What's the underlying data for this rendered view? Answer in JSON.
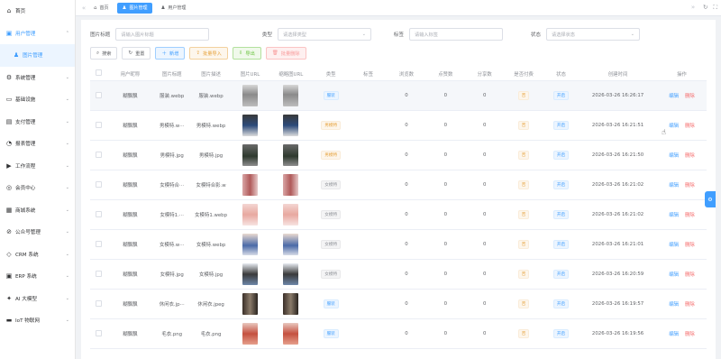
{
  "sidebar": {
    "items": [
      {
        "label": "首页",
        "icon": "home-icon",
        "glyph": "⌂",
        "chevron": ""
      },
      {
        "label": "用户管理",
        "icon": "user-manage-icon",
        "glyph": "▣",
        "chevron": "⌃",
        "state": "open"
      },
      {
        "label": "图片管理",
        "icon": "user-icon",
        "glyph": "♟",
        "chevron": "",
        "state": "sub"
      },
      {
        "label": "系统管理",
        "icon": "system-icon",
        "glyph": "⚙",
        "chevron": "⌄"
      },
      {
        "label": "基础设施",
        "icon": "monitor-icon",
        "glyph": "▭",
        "chevron": "⌄"
      },
      {
        "label": "支付管理",
        "icon": "pay-icon",
        "glyph": "▤",
        "chevron": "⌄"
      },
      {
        "label": "报表管理",
        "icon": "report-icon",
        "glyph": "◔",
        "chevron": "⌄"
      },
      {
        "label": "工作流程",
        "icon": "flow-icon",
        "glyph": "▶",
        "chevron": "⌄"
      },
      {
        "label": "会员中心",
        "icon": "member-icon",
        "glyph": "◎",
        "chevron": "⌄"
      },
      {
        "label": "商城系统",
        "icon": "shop-icon",
        "glyph": "▦",
        "chevron": "⌄"
      },
      {
        "label": "公众号管理",
        "icon": "wechat-icon",
        "glyph": "⊘",
        "chevron": "⌄"
      },
      {
        "label": "CRM 系统",
        "icon": "crm-icon",
        "glyph": "◇",
        "chevron": "⌄"
      },
      {
        "label": "ERP 系统",
        "icon": "erp-icon",
        "glyph": "▣",
        "chevron": "⌄"
      },
      {
        "label": "AI 大模型",
        "icon": "ai-icon",
        "glyph": "✦",
        "chevron": "⌄"
      },
      {
        "label": "IoT 物联网",
        "icon": "iot-icon",
        "glyph": "▬",
        "chevron": "⌄"
      }
    ]
  },
  "tabs": {
    "prev": "«",
    "next": "»",
    "items": [
      {
        "label": "首页",
        "glyph": "⌂",
        "active": false
      },
      {
        "label": "图片管理",
        "glyph": "♟",
        "active": true
      },
      {
        "label": "用户管理",
        "glyph": "♟",
        "active": false
      }
    ],
    "refresh": "↻",
    "fullscreen": "⛶"
  },
  "search": {
    "title_label": "图片标题",
    "title_placeholder": "请输入图片标题",
    "type_label": "类型",
    "type_placeholder": "请选择类型",
    "tag_label": "标签",
    "tag_placeholder": "请输入标签",
    "status_label": "状态",
    "status_placeholder": "请选择状态"
  },
  "actions": {
    "search": "搜索",
    "reset": "重置",
    "add": "新增",
    "import": "批量导入",
    "export": "导出",
    "batch_delete": "批量删除"
  },
  "table": {
    "headers": {
      "nick": "用户昵称",
      "title": "图片标题",
      "desc": "图片描述",
      "url": "图片URL",
      "thumb": "缩略图URL",
      "type": "类型",
      "tag": "标签",
      "views": "浏览数",
      "likes": "点赞数",
      "shares": "分享数",
      "paid": "是否付费",
      "status": "状态",
      "created": "创建时间",
      "ops": "操作"
    },
    "edit_label": "编辑",
    "delete_label": "删除",
    "rows": [
      {
        "nick": "糊飘飘",
        "title": "服装.webp",
        "desc": "服装.webp",
        "type": "服装",
        "type_color": "blue",
        "tag": "",
        "views": "0",
        "likes": "0",
        "shares": "0",
        "paid": "否",
        "status": "开启",
        "created": "2026-03-26 16:26:17",
        "img": "cloth"
      },
      {
        "nick": "糊飘飘",
        "title": "男模特.w···",
        "desc": "男模特.webp",
        "type": "男模特",
        "type_color": "orange",
        "tag": "",
        "views": "0",
        "likes": "0",
        "shares": "0",
        "paid": "否",
        "status": "开启",
        "created": "2026-03-26 16:21:51",
        "img": "man"
      },
      {
        "nick": "糊飘飘",
        "title": "男模特.jpg",
        "desc": "男模特.jpg",
        "type": "男模特",
        "type_color": "orange",
        "tag": "",
        "views": "0",
        "likes": "0",
        "shares": "0",
        "paid": "否",
        "status": "开启",
        "created": "2026-03-26 16:21:50",
        "img": "mandark"
      },
      {
        "nick": "糊飘飘",
        "title": "女模特合···",
        "desc": "女模特合影.w",
        "type": "女模特",
        "type_color": "gray",
        "tag": "",
        "views": "0",
        "likes": "0",
        "shares": "0",
        "paid": "否",
        "status": "开启",
        "created": "2026-03-26 16:21:02",
        "img": "group"
      },
      {
        "nick": "糊飘飘",
        "title": "女模特1.···",
        "desc": "女模特1.webp",
        "type": "女模特",
        "type_color": "gray",
        "tag": "",
        "views": "0",
        "likes": "0",
        "shares": "0",
        "paid": "否",
        "status": "开启",
        "created": "2026-03-26 16:21:02",
        "img": "woman"
      },
      {
        "nick": "糊飘飘",
        "title": "女模特.w···",
        "desc": "女模特.webp",
        "type": "女模特",
        "type_color": "gray",
        "tag": "",
        "views": "0",
        "likes": "0",
        "shares": "0",
        "paid": "否",
        "status": "开启",
        "created": "2026-03-26 16:21:01",
        "img": "woman2"
      },
      {
        "nick": "糊飘飘",
        "title": "女模特.jpg",
        "desc": "女模特.jpg",
        "type": "女模特",
        "type_color": "gray",
        "tag": "",
        "views": "0",
        "likes": "0",
        "shares": "0",
        "paid": "否",
        "status": "开启",
        "created": "2026-03-26 16:20:59",
        "img": "woman3"
      },
      {
        "nick": "糊飘飘",
        "title": "休闲衣.jp···",
        "desc": "休闲衣.jpeg",
        "type": "服装",
        "type_color": "blue",
        "tag": "",
        "views": "0",
        "likes": "0",
        "shares": "0",
        "paid": "否",
        "status": "开启",
        "created": "2026-03-26 16:19:57",
        "img": "casual"
      },
      {
        "nick": "糊飘飘",
        "title": "毛衣.png",
        "desc": "毛衣.png",
        "type": "服装",
        "type_color": "blue",
        "tag": "",
        "views": "0",
        "likes": "0",
        "shares": "0",
        "paid": "否",
        "status": "开启",
        "created": "2026-03-26 16:19:56",
        "img": "sweater"
      }
    ]
  },
  "colors": {
    "primary": "#409eff",
    "danger": "#f56c6c",
    "warning": "#e6a23c",
    "success": "#67c23a"
  }
}
